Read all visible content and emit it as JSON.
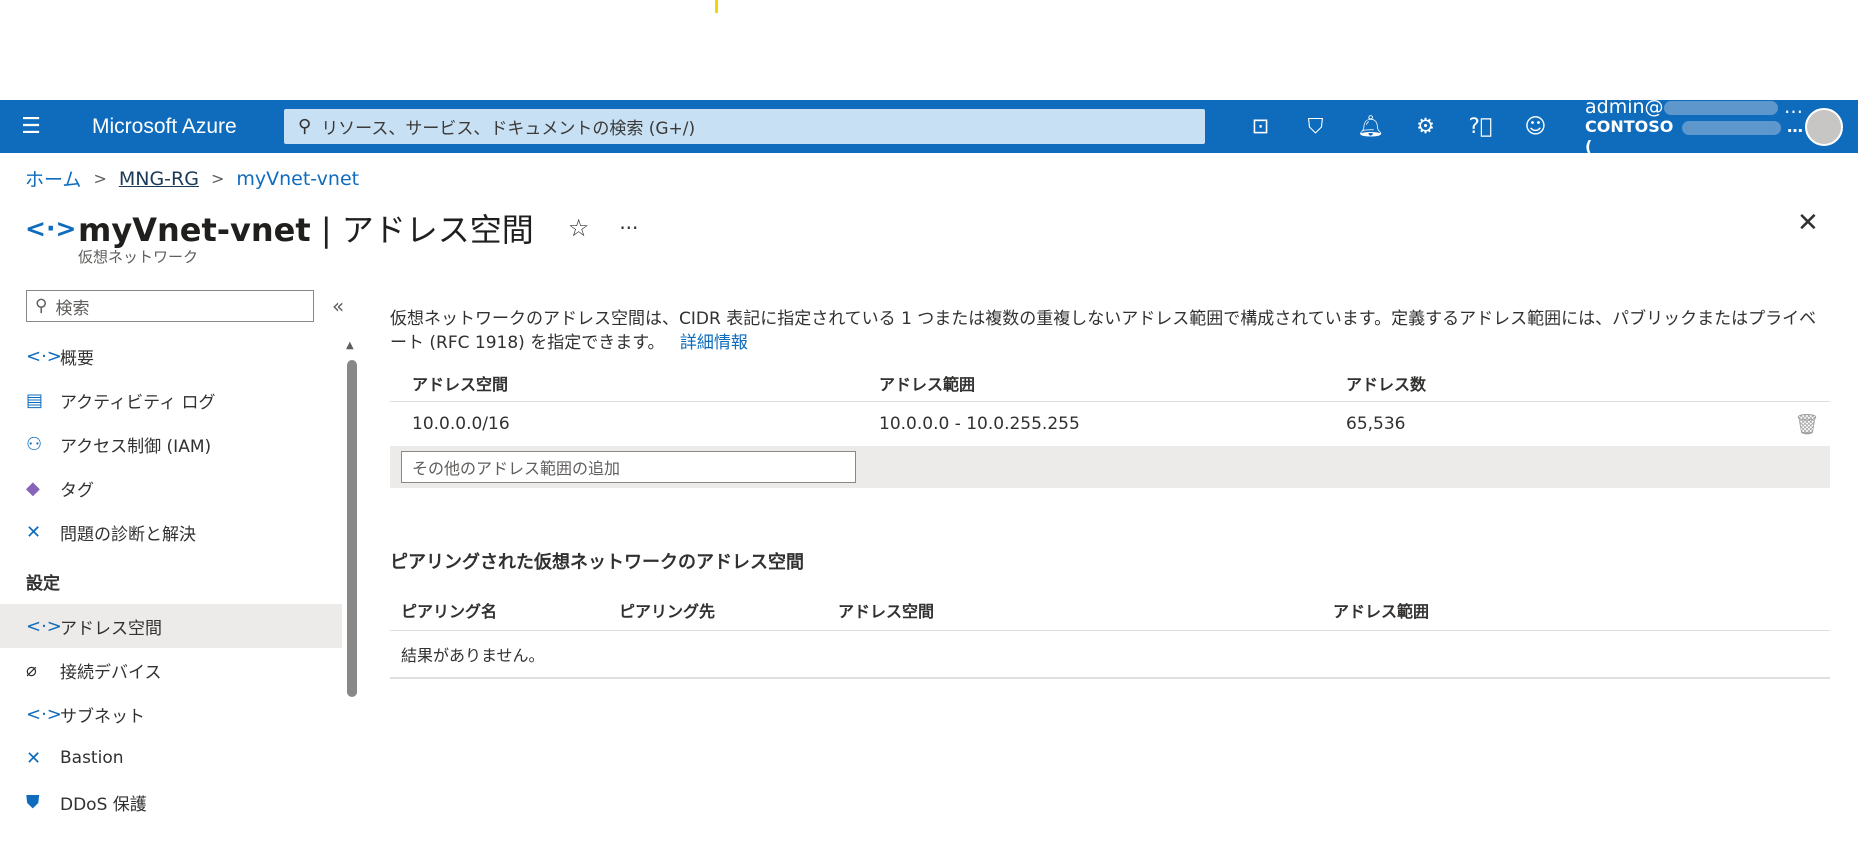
{
  "header": {
    "brand": "Microsoft Azure",
    "search_placeholder": "リソース、サービス、ドキュメントの検索 (G+/)",
    "account_user": "admin@",
    "account_org": "CONTOSO (",
    "account_more": "…",
    "icons": [
      "cloud-shell-icon",
      "directory-filter-icon",
      "bell-icon",
      "gear-icon",
      "help-icon",
      "feedback-icon"
    ]
  },
  "breadcrumb": {
    "home": "ホーム",
    "rg": "MNG-RG",
    "current": "myVnet-vnet",
    "sep": ">"
  },
  "page": {
    "title_resource": "myVnet-vnet",
    "title_sep": " | ",
    "title_blade": "アドレス空間",
    "subtitle": "仮想ネットワーク",
    "star": "☆",
    "more": "···",
    "close": "✕"
  },
  "sidebar": {
    "search_placeholder": "検索",
    "collapse": "«",
    "items": [
      {
        "label": "概要",
        "icon": "<·>"
      },
      {
        "label": "アクティビティ ログ",
        "icon": "▤"
      },
      {
        "label": "アクセス制御 (IAM)",
        "icon": "⚇"
      },
      {
        "label": "タグ",
        "icon": "◆"
      },
      {
        "label": "問題の診断と解決",
        "icon": "✕"
      }
    ],
    "section": "設定",
    "settings_items": [
      {
        "label": "アドレス空間",
        "icon": "<·>"
      },
      {
        "label": "接続デバイス",
        "icon": "⌀"
      },
      {
        "label": "サブネット",
        "icon": "<·>"
      },
      {
        "label": "Bastion",
        "icon": "✕"
      },
      {
        "label": "DDoS 保護",
        "icon": "⛊"
      }
    ]
  },
  "main": {
    "description": "仮想ネットワークのアドレス空間は、CIDR 表記に指定されている 1 つまたは複数の重複しないアドレス範囲で構成されています。定義するアドレス範囲には、パブリックまたはプライベート (RFC 1918) を指定できます。",
    "learn_more": "詳細情報",
    "table": {
      "headers": [
        "アドレス空間",
        "アドレス範囲",
        "アドレス数"
      ],
      "rows": [
        {
          "space": "10.0.0.0/16",
          "range": "10.0.0.0 - 10.0.255.255",
          "count": "65,536"
        }
      ],
      "add_placeholder": "その他のアドレス範囲の追加"
    },
    "peered_title": "ピアリングされた仮想ネットワークのアドレス空間",
    "peered_headers": [
      "ピアリング名",
      "ピアリング先",
      "アドレス空間",
      "アドレス範囲"
    ],
    "peered_empty": "結果がありません。"
  }
}
